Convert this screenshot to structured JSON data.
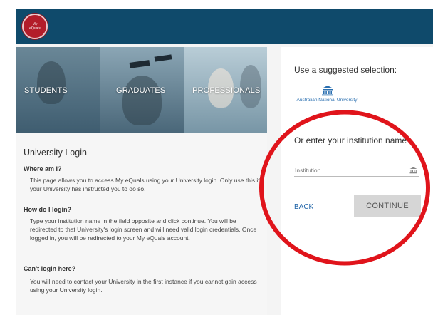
{
  "header": {
    "logo_text_line1": "My",
    "logo_text_line2": "eQuals"
  },
  "hero": {
    "labels": [
      "STUDENTS",
      "GRADUATES",
      "PROFESSIONALS"
    ]
  },
  "login_info": {
    "title": "University Login",
    "sections": [
      {
        "question": "Where am I?",
        "answer": "This page allows you to access My eQuals using your University login. Only use this if your University has instructed you to do so."
      },
      {
        "question": "How do I login?",
        "answer": "Type your institution name in the field opposite and click continue. You will be redirected to that University's login screen and will need valid login credentials. Once logged in, you will be redirected to your My eQuals account."
      },
      {
        "question": "Can't login here?",
        "answer": "You will need to contact your University in the first instance if you cannot gain access using your University login."
      }
    ]
  },
  "selection": {
    "suggested_label": "Use a suggested selection:",
    "suggested_institution": "Australian National University",
    "or_enter_label": "Or enter your institution name",
    "institution_placeholder": "Institution",
    "institution_value": "",
    "back_label": "BACK",
    "continue_label": "CONTINUE"
  },
  "colors": {
    "header_bg": "#0f4a6b",
    "link": "#1f64a8",
    "annotation_circle": "#e0141b",
    "button_bg": "#d6d6d6"
  },
  "icons": {
    "institution": "institution-building-icon",
    "input_institution": "institution-building-icon"
  }
}
